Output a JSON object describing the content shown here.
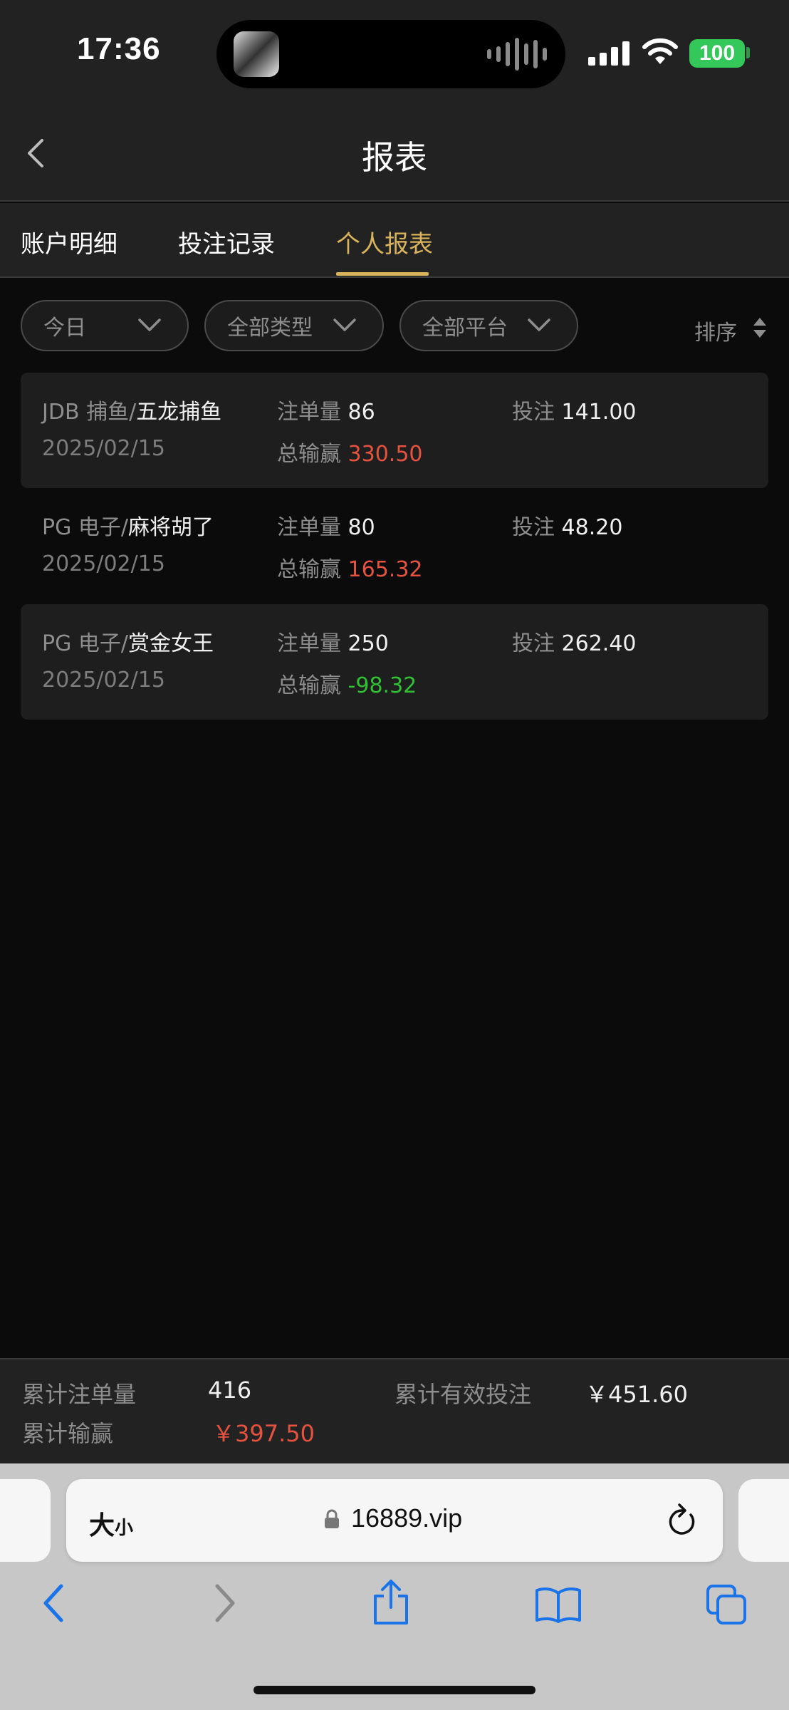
{
  "status_bar": {
    "time": "17:36",
    "battery": "100"
  },
  "header": {
    "title": "报表"
  },
  "tabs": [
    {
      "label": "账户明细",
      "active": false
    },
    {
      "label": "投注记录",
      "active": false
    },
    {
      "label": "个人报表",
      "active": true
    }
  ],
  "filters": {
    "date": "今日",
    "type": "全部类型",
    "platform": "全部平台",
    "sort": "排序"
  },
  "labels": {
    "count": "注单量",
    "win": "总输赢",
    "bet": "投注"
  },
  "records": [
    {
      "platform": "JDB 捕鱼/",
      "game": "五龙捕鱼",
      "date": "2025/02/15",
      "count": "86",
      "win": "330.50",
      "win_color": "red",
      "bet": "141.00"
    },
    {
      "platform": "PG 电子/",
      "game": "麻将胡了",
      "date": "2025/02/15",
      "count": "80",
      "win": "165.32",
      "win_color": "red",
      "bet": "48.20"
    },
    {
      "platform": "PG 电子/",
      "game": "赏金女王",
      "date": "2025/02/15",
      "count": "250",
      "win": "-98.32",
      "win_color": "green",
      "bet": "262.40"
    }
  ],
  "summary": {
    "count_label": "累计注单量",
    "count_value": "416",
    "valid_bet_label": "累计有效投注",
    "valid_bet_value": "￥451.60",
    "win_label": "累计输赢",
    "win_value": "￥397.50"
  },
  "browser": {
    "aa_big": "大",
    "aa_small": "小",
    "url": "16889.vip"
  },
  "colors": {
    "accent": "#d8b35b",
    "positive": "#e5533f",
    "negative": "#2fc233",
    "battery": "#34c759"
  },
  "icons": [
    "back-chevron-icon",
    "chevron-down-icon",
    "sort-icon",
    "lock-icon",
    "reload-icon",
    "share-icon",
    "bookmarks-icon",
    "tabs-icon"
  ]
}
